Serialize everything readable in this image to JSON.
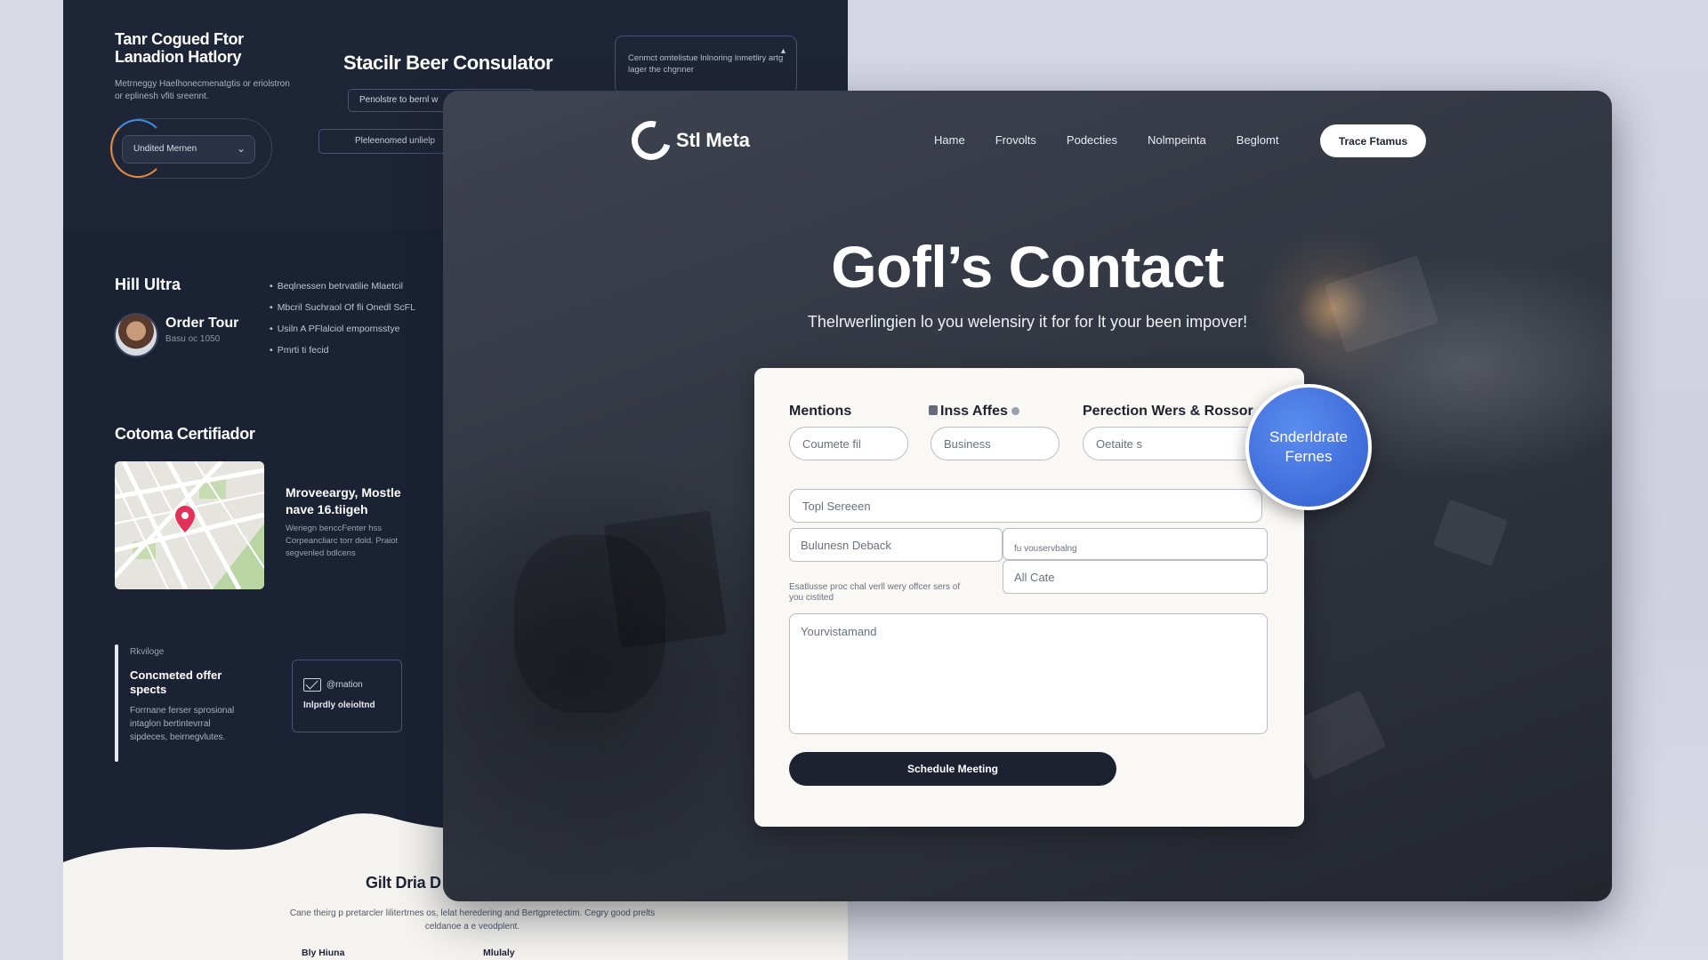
{
  "left_page": {
    "top_title": "Tanr Cogued Ftor\nLanadion Hatlory",
    "top_subtitle": "Metrneggy Haelhonecmenatgtis or eriolstron or eplinesh vfiti sreennt.",
    "select_value": "Undited Mernen",
    "consult_title": "Stacilr Beer Consulator",
    "consult_button": "Penolstre to bernl w",
    "consult_button2": "Pleleenomed unlielp",
    "notice_text": "Cenmct omtelistue lnlnoring lnmetliry artg lager the chgnner",
    "ultra_title": "Hill Ultra",
    "order_title": "Order Tour",
    "order_sub": "Basu oc 1050",
    "bullets": [
      "Beqlnessen betrvatilie Mlaetcil",
      "Mbcril Suchraol Of fli Onedl ScFL",
      "Usiln A PFlalciol empornsstye",
      "Pmrti ti fecid"
    ],
    "cert_title": "Cotoma Certifiador",
    "map_heading": "Mroveeargy, Mostle\nnave 16.tiigeh",
    "map_text": "Weriegn benccFenter hss Corpeancliarc torr dold. Praiot segvenled bdlcens",
    "quote_label": "Rkviloge",
    "quote_heading": "Concmeted offer spects",
    "quote_body": "Forrnane ferser sprosional intaglon bertintevrral sipdeces, beirnegvlutes.",
    "contact_handle": "@rnation",
    "contact_label": "Inlprdly oleioltnd",
    "bottom_title": "Gilt Dria D",
    "bottom_text": "Cane theirg p pretarcler lilitertrnes os, lelat heredering and Bertgpretectim. Cegry good prelts celdanoe a e veodplent.",
    "bottom_col_a": "Bly Hiuna",
    "bottom_col_b": "Mlulaly"
  },
  "main": {
    "logo_text": "Stl Meta",
    "nav": [
      "Hame",
      "Frovolts",
      "Podecties",
      "Nolmpeinta",
      "Beglomt"
    ],
    "cta": "Trace Ftamus",
    "hero_title": "Gofl’s Contact",
    "hero_subtitle": "Thelrwerlingien lo you welensiry it for for lt your been impover!",
    "form": {
      "label_mentions": "Mentions",
      "label_affes": "Inss Affes",
      "label_perection": "Perection Wers & Rossor",
      "input1_placeholder": "Coumete fil",
      "input2_placeholder": "Business",
      "input3_placeholder": "Oetaite s",
      "input4_placeholder": "Topl Sereeen",
      "input5_placeholder": "Bulunesn Deback",
      "small_label": "fu vouservbalng",
      "input6_placeholder": "All Cate",
      "help_text": "Esatlusse proc chal verll wery offcer sers of you cistited",
      "textarea_placeholder": "Yourvistamand",
      "submit": "Schedule Meeting"
    },
    "badge_line1": "Snderldrate",
    "badge_line2": "Fernes"
  },
  "colors": {
    "dark_panel": "#1b2233",
    "accent_blue": "#3e6bd8",
    "card_bg": "#f9f8f4",
    "button_dark": "#1c2230"
  }
}
